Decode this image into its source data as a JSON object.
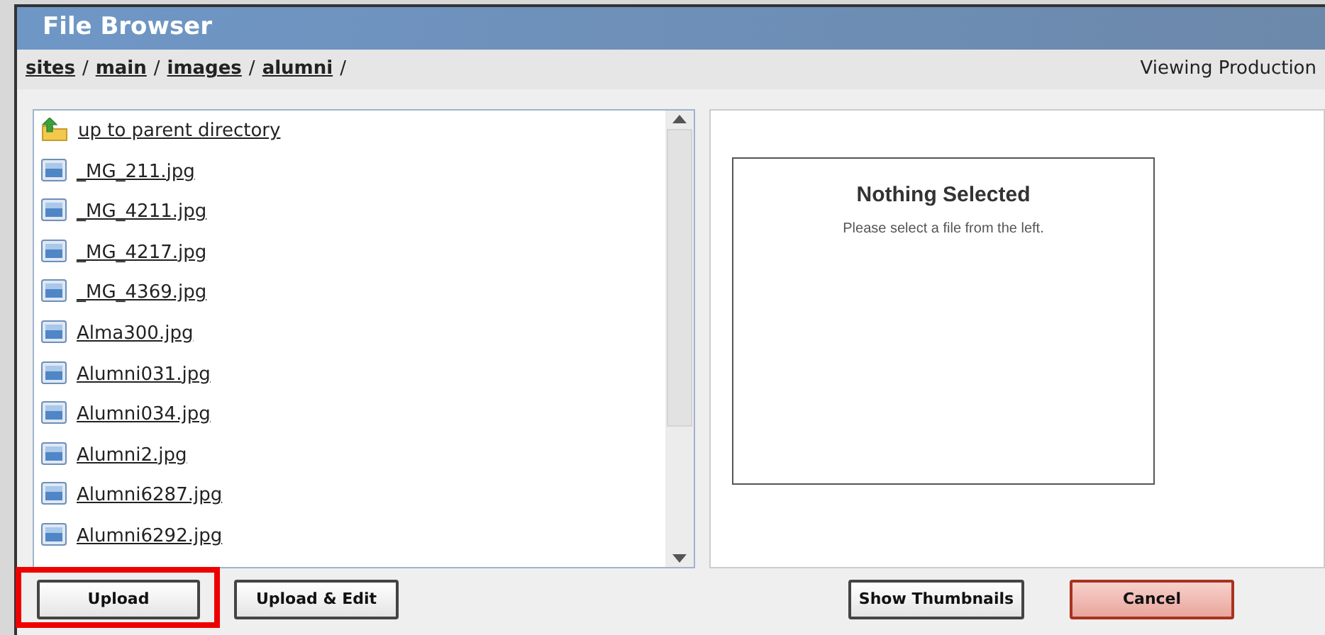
{
  "window": {
    "title": "File Browser"
  },
  "breadcrumb": [
    {
      "label": "sites",
      "separator": "/"
    },
    {
      "label": "main",
      "separator": "/"
    },
    {
      "label": "images",
      "separator": "/"
    },
    {
      "label": "alumni",
      "separator": "/"
    }
  ],
  "view_mode": "Viewing Production",
  "files": [
    {
      "name": "up to parent directory",
      "kind": "parent"
    },
    {
      "name": "_MG_211.jpg",
      "kind": "image"
    },
    {
      "name": "_MG_4211.jpg",
      "kind": "image"
    },
    {
      "name": "_MG_4217.jpg",
      "kind": "image"
    },
    {
      "name": "_MG_4369.jpg",
      "kind": "image"
    },
    {
      "name": "Alma300.jpg",
      "kind": "image"
    },
    {
      "name": "Alumni031.jpg",
      "kind": "image"
    },
    {
      "name": "Alumni034.jpg",
      "kind": "image"
    },
    {
      "name": "Alumni2.jpg",
      "kind": "image"
    },
    {
      "name": "Alumni6287.jpg",
      "kind": "image"
    },
    {
      "name": "Alumni6292.jpg",
      "kind": "image"
    }
  ],
  "preview": {
    "title": "Nothing Selected",
    "message": "Please select a file from the left."
  },
  "buttons_left": [
    {
      "label": "Upload",
      "kind": "default",
      "highlighted": true
    },
    {
      "label": "Upload & Edit",
      "kind": "default",
      "highlighted": false
    }
  ],
  "buttons_right": [
    {
      "label": "Show Thumbnails",
      "kind": "default",
      "highlighted": false
    },
    {
      "label": "Cancel",
      "kind": "danger",
      "highlighted": false
    }
  ]
}
